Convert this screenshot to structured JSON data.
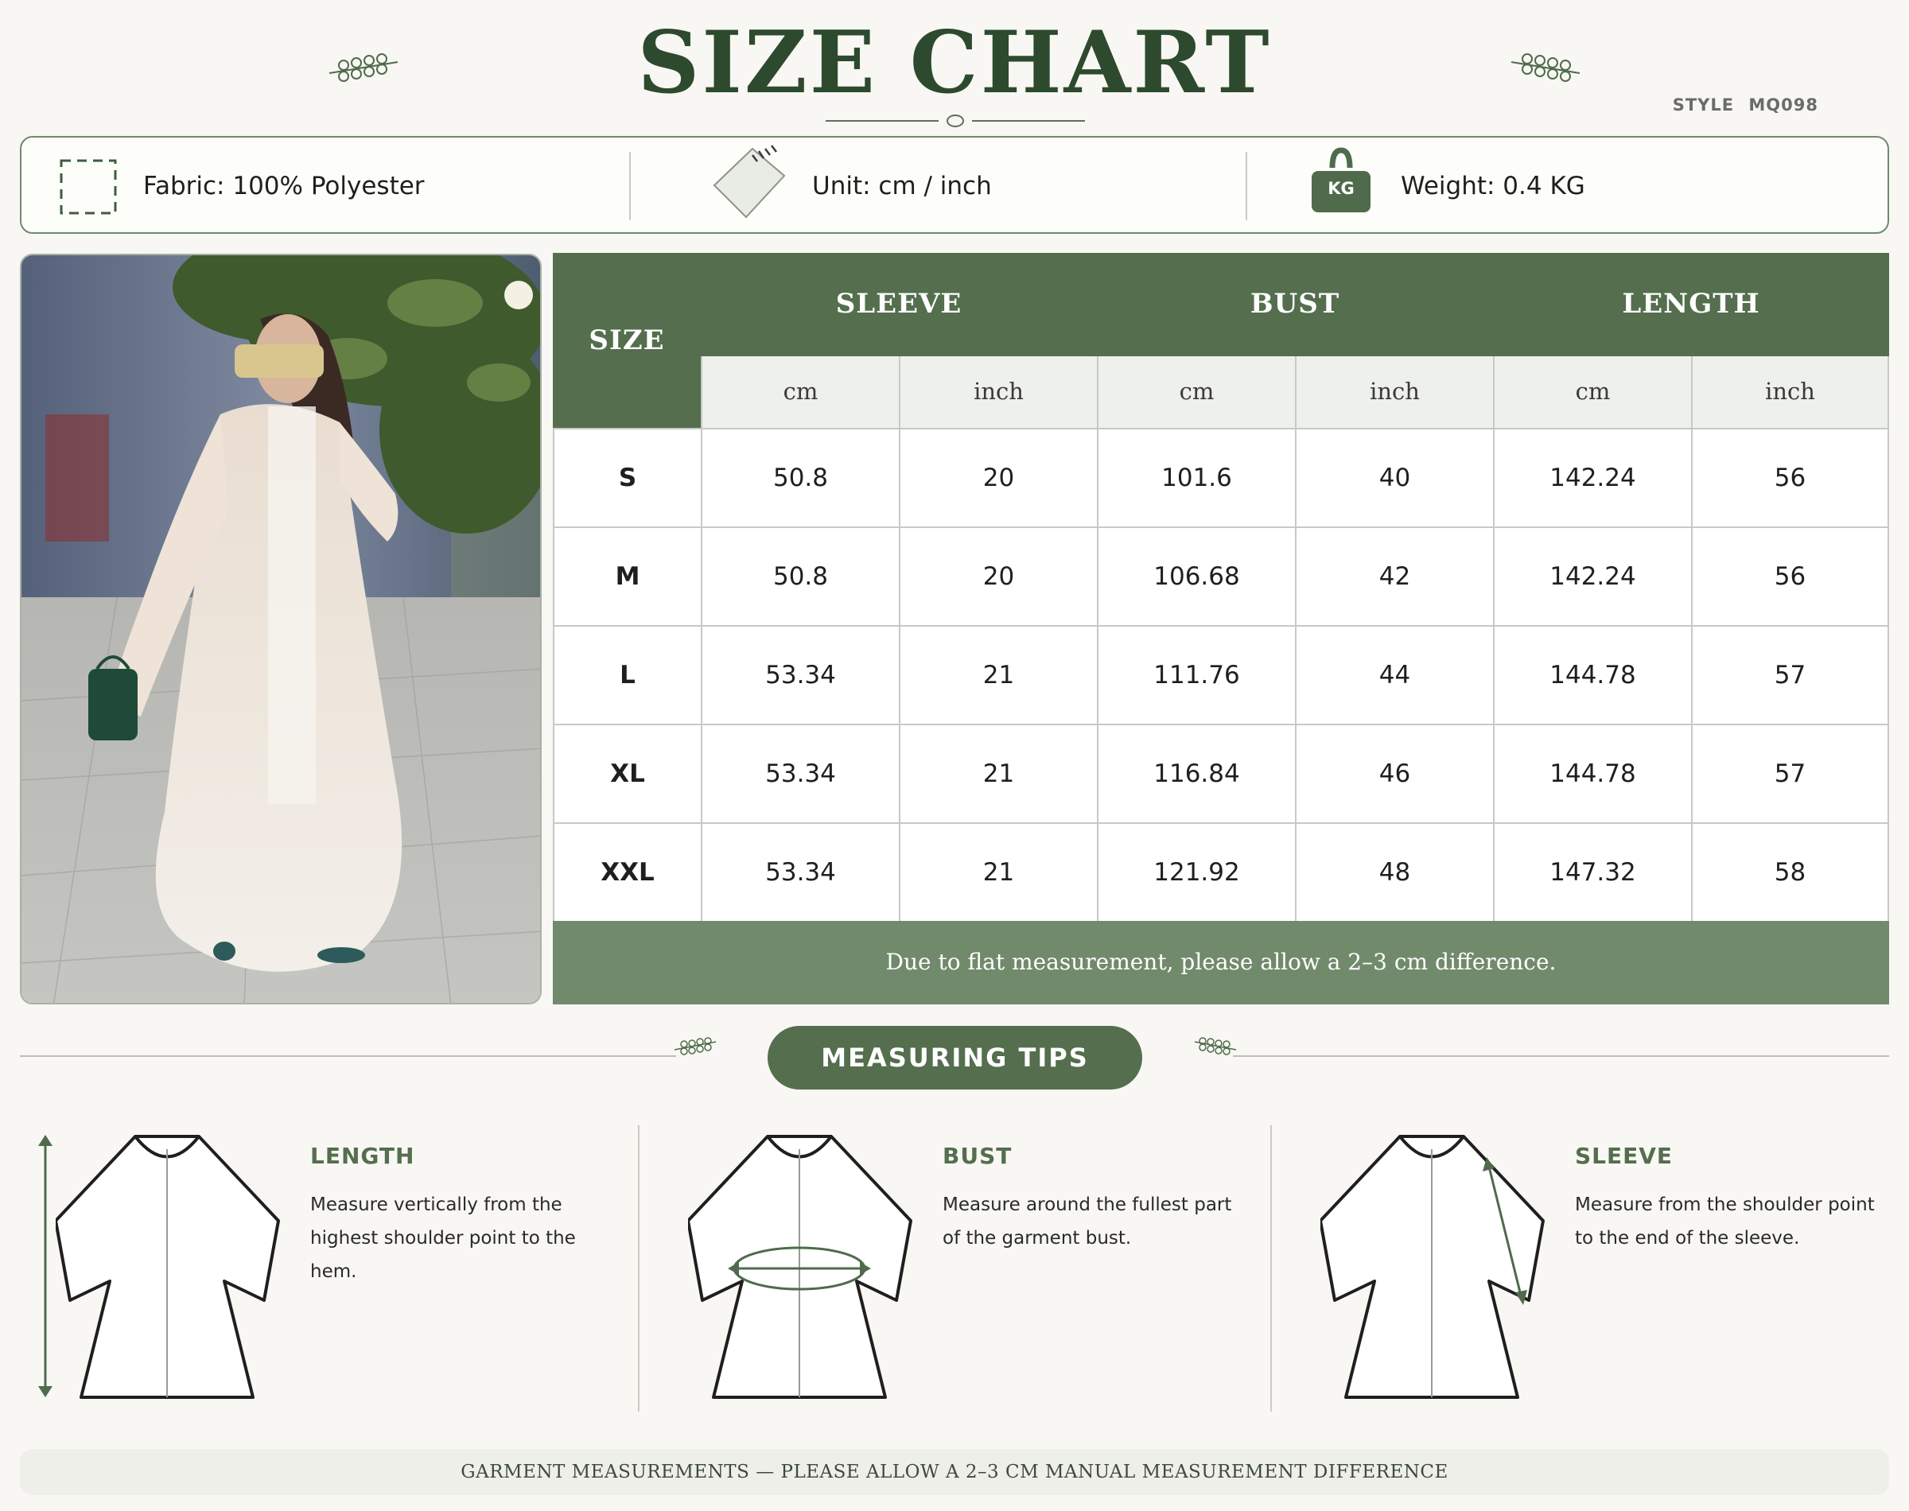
{
  "header": {
    "title": "SIZE CHART",
    "style_code": "STYLE  MQ098"
  },
  "info": {
    "fabric": "Fabric: 100% Polyester",
    "unit": "Unit: cm / inch",
    "weight": "Weight: 0.4 KG",
    "kg_badge": "KG"
  },
  "table": {
    "size_header": "SIZE",
    "groups": [
      "SLEEVE",
      "BUST",
      "LENGTH"
    ],
    "units": [
      "cm",
      "inch",
      "cm",
      "inch",
      "cm",
      "inch"
    ],
    "rows": [
      {
        "size": "S",
        "values": [
          "50.8",
          "20",
          "101.6",
          "40",
          "142.24",
          "56"
        ]
      },
      {
        "size": "M",
        "values": [
          "50.8",
          "20",
          "106.68",
          "42",
          "142.24",
          "56"
        ]
      },
      {
        "size": "L",
        "values": [
          "53.34",
          "21",
          "111.76",
          "44",
          "144.78",
          "57"
        ]
      },
      {
        "size": "XL",
        "values": [
          "53.34",
          "21",
          "116.84",
          "46",
          "144.78",
          "57"
        ]
      },
      {
        "size": "XXL",
        "values": [
          "53.34",
          "21",
          "121.92",
          "48",
          "147.32",
          "58"
        ]
      }
    ],
    "note": "Due to flat measurement, please allow a 2–3 cm difference."
  },
  "tips": {
    "title": "MEASURING TIPS",
    "items": [
      {
        "heading": "LENGTH",
        "text": "Measure vertically from the highest shoulder point to the hem."
      },
      {
        "heading": "BUST",
        "text": "Measure around the fullest part of the garment bust."
      },
      {
        "heading": "SLEEVE",
        "text": "Measure from the shoulder point to the end of the sleeve."
      }
    ]
  },
  "footer": {
    "text": "GARMENT MEASUREMENTS — PLEASE ALLOW A 2–3 CM MANUAL MEASUREMENT DIFFERENCE"
  },
  "colors": {
    "brand_green": "#546e4e",
    "title_green": "#2d4a2e",
    "note_green": "#728a6c",
    "background": "#f8f7f3"
  },
  "icons": {
    "fabric": "dashed-square-icon",
    "unit": "ruler-tag-icon",
    "weight": "kg-weight-icon",
    "ornament": "sprig-ornament-icon"
  }
}
